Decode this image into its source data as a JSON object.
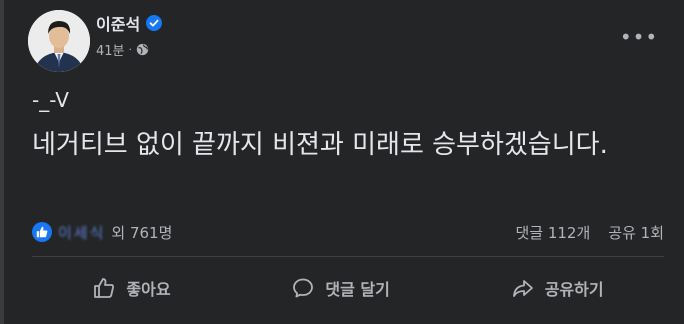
{
  "post": {
    "author": "이준석",
    "time": "41분",
    "line1": "-_-V",
    "line2": "네거티브 없이 끝까지 비젼과 미래로 승부하겠습니다."
  },
  "reactions": {
    "names": "이세식",
    "others": "외 761명",
    "comments": "댓글 112개",
    "shares": "공유 1회"
  },
  "actions": {
    "like": "좋아요",
    "comment": "댓글 달기",
    "share": "공유하기"
  },
  "colors": {
    "background": "#242526",
    "text": "#e4e6eb",
    "secondary_text": "#b0b3b8",
    "accent": "#1877f2"
  }
}
